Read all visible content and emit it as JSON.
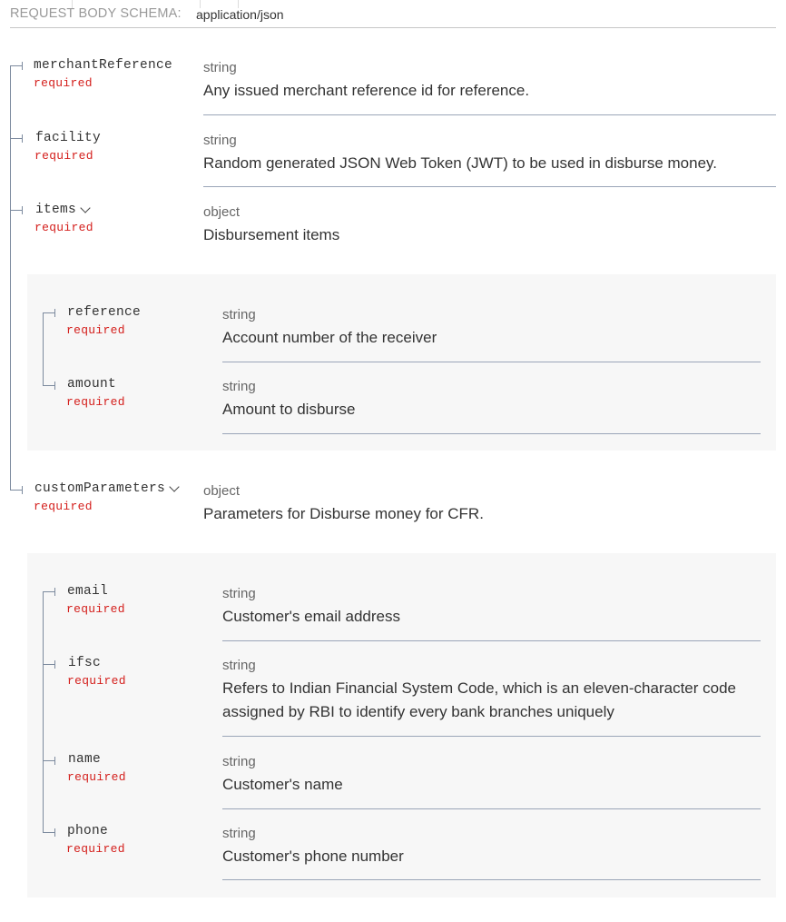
{
  "header": {
    "label": "REQUEST BODY SCHEMA:",
    "content_type": "application/json"
  },
  "required_label": "required",
  "fields": {
    "merchantReference": {
      "name": "merchantReference",
      "type": "string",
      "description": "Any issued merchant reference id for reference."
    },
    "facility": {
      "name": "facility",
      "type": "string",
      "description": "Random generated JSON Web Token (JWT) to be used in disburse money."
    },
    "items": {
      "name": "items",
      "type": "object",
      "description": "Disbursement items",
      "children": {
        "reference": {
          "name": "reference",
          "type": "string",
          "description": "Account number of the receiver"
        },
        "amount": {
          "name": "amount",
          "type": "string",
          "description": "Amount to disburse"
        }
      }
    },
    "customParameters": {
      "name": "customParameters",
      "type": "object",
      "description": "Parameters for Disburse money for CFR.",
      "children": {
        "email": {
          "name": "email",
          "type": "string",
          "description": "Customer's email address"
        },
        "ifsc": {
          "name": "ifsc",
          "type": "string",
          "description": "Refers to Indian Financial System Code, which is an eleven-character code assigned by RBI to identify every bank branches uniquely"
        },
        "name": {
          "name": "name",
          "type": "string",
          "description": "Customer's name"
        },
        "phone": {
          "name": "phone",
          "type": "string",
          "description": "Customer's phone number"
        }
      }
    }
  }
}
